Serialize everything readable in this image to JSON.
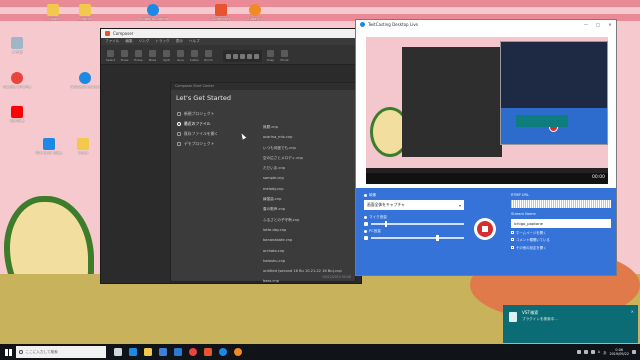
{
  "desktop": {
    "icons": [
      {
        "label": "ごみ箱",
        "icon": "recycle-bin-icon",
        "color": "#9fb6c9"
      },
      {
        "label": "Google Chrome",
        "icon": "chrome-icon",
        "color": "#e8453c"
      },
      {
        "label": "YouTube",
        "icon": "youtube-icon",
        "color": "#ff0000"
      },
      {
        "label": "Microsoft Edge",
        "icon": "edge-icon",
        "color": "#1e88e5"
      },
      {
        "label": "Video",
        "icon": "folder-icon",
        "color": "#f2c94c"
      },
      {
        "label": "Google",
        "icon": "folder-icon",
        "color": "#f2c94c"
      },
      {
        "label": "TwitCasting Desktop Live",
        "icon": "twitcasting-icon",
        "color": "#1e88e5"
      },
      {
        "label": "Sample",
        "icon": "folder-icon",
        "color": "#f2c94c"
      },
      {
        "label": "SongbirdComposer",
        "icon": "songbird-icon",
        "color": "#1e88e5"
      },
      {
        "label": "Composer",
        "icon": "composer-icon",
        "color": "#e6552f"
      },
      {
        "label": "Audacity",
        "icon": "audacity-icon",
        "color": "#f08a24"
      }
    ]
  },
  "composer": {
    "title": "Composer",
    "menu": [
      "ファイル",
      "編集",
      "ソング",
      "トラック",
      "表示",
      "ヘルプ"
    ],
    "tools": [
      "Select",
      "Draw",
      "Erase",
      "Mute",
      "Split",
      "Glue",
      "Listen",
      "Zoom"
    ],
    "transport_tools": [
      "Snap",
      "Mode"
    ]
  },
  "start_dialog": {
    "titlebar": "Composer Start Center",
    "heading": "Let's Get Started",
    "nav": [
      "新規プロジェクト",
      "最近のファイル",
      "既存ファイルを開く",
      "デモプロジェクト"
    ],
    "active_nav_index": 1,
    "files": [
      "無題.cnp",
      "ocarina_mix.cnp",
      "いつも何度でも.cnp",
      "空の広さとメロディ.cnp",
      "ただいま.cnp",
      "sample.cnp",
      "melody.cnp",
      "練習曲.cnp",
      "春の歌声.cnp",
      "ふるさとの子守唄.cnp",
      "lotte-day.cnp",
      "bananabate.cnp",
      "orchata.cnp",
      "hatoshu.cnp",
      "untitled (second 16 Bu 10.21.22 16 Bu).cnp",
      "bass.cnp"
    ],
    "footer_date": "09/22/2019 00:06"
  },
  "twitcasting": {
    "title": "TwitCasting Desktop Live",
    "win_buttons": [
      "—",
      "□",
      "✕"
    ],
    "elapsed": "00:00",
    "panel": {
      "source_label": "映像",
      "source_value": "画面全体をキャプチャ",
      "mic_label": "マイク音量",
      "pc_label": "PC音量",
      "mic_level": 0.15,
      "pc_level": 0.7,
      "rtmp_label": "RTMP URL",
      "stream_name_label": "Stream Name",
      "stream_name_value": "ichigo_poptone",
      "links": [
        "ホームページを開く",
        "コメント欄開いている",
        "その他の設定を開く"
      ]
    }
  },
  "toast": {
    "title": "VST検索",
    "body": "プラグインを検索中...",
    "close": "✕"
  },
  "taskbar": {
    "search_placeholder": "ここに入力して検索",
    "apps": [
      {
        "icon": "task-view-icon",
        "color": "#cfd8dc"
      },
      {
        "icon": "edge-icon",
        "color": "#1e88e5"
      },
      {
        "icon": "explorer-icon",
        "color": "#f2c94c"
      },
      {
        "icon": "store-icon",
        "color": "#3f7fd8"
      },
      {
        "icon": "mail-icon",
        "color": "#2a7ad2"
      },
      {
        "icon": "chrome-icon",
        "color": "#e8453c"
      },
      {
        "icon": "composer-icon",
        "color": "#e6552f"
      },
      {
        "icon": "twitcasting-icon",
        "color": "#1e88e5"
      },
      {
        "icon": "audacity-icon",
        "color": "#f08a24"
      }
    ],
    "tray_lang": "A",
    "tray_ime": "あ",
    "time": "0:06",
    "date": "2019/09/22"
  }
}
